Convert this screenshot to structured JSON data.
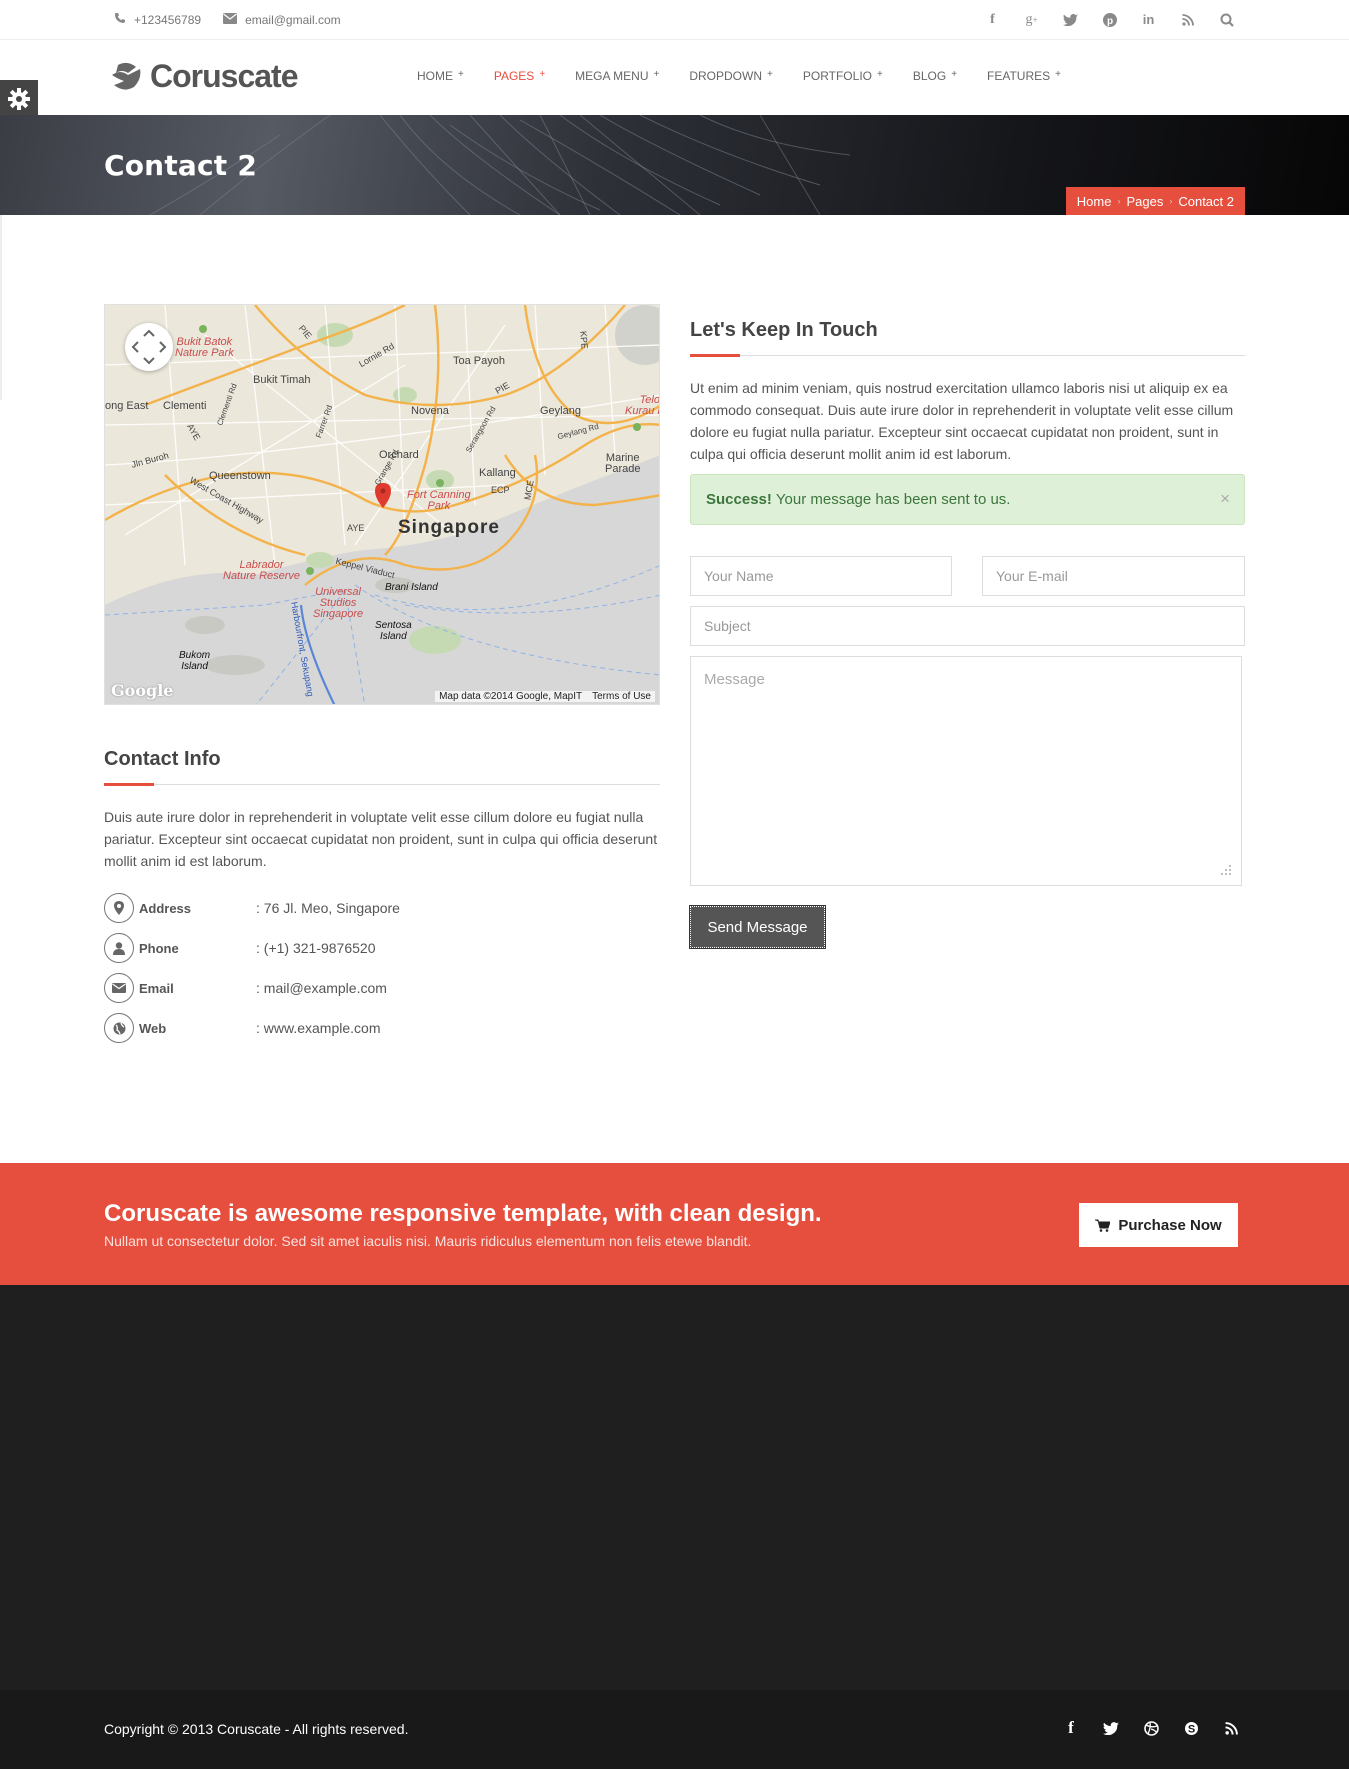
{
  "topbar": {
    "phone": "+123456789",
    "email": "email@gmail.com",
    "social_icons": [
      "facebook-icon",
      "google-plus-icon",
      "twitter-icon",
      "pinterest-icon",
      "linkedin-icon",
      "rss-icon",
      "search-icon"
    ]
  },
  "header": {
    "logo_text": "Coruscate",
    "nav": [
      {
        "label": "HOME",
        "plus": "+"
      },
      {
        "label": "PAGES",
        "plus": "+"
      },
      {
        "label": "MEGA MENU",
        "plus": "+"
      },
      {
        "label": "DROPDOWN",
        "plus": "+"
      },
      {
        "label": "PORTFOLIO",
        "plus": "+"
      },
      {
        "label": "BLOG",
        "plus": "+"
      },
      {
        "label": "FEATURES",
        "plus": "+"
      }
    ],
    "active_nav": "PAGES"
  },
  "banner": {
    "title": "Contact 2",
    "breadcrumb": [
      "Home",
      "Pages",
      "Contact 2"
    ],
    "breadcrumb_sep": "›"
  },
  "map": {
    "labels": {
      "bukit_batok": "Bukit Batok\nNature Park",
      "bukit_timah": "Bukit Timah",
      "toa_payoh": "Toa Payoh",
      "clementi": "Clementi",
      "jong_east": "ong East",
      "novena": "Novena",
      "geylang": "Geylang",
      "telok": "Telok\nKurau Park",
      "orchard": "Orchard",
      "queenstown": "Queenstown",
      "kallang": "Kallang",
      "marine_parade": "Marine\nParade",
      "fort_canning": "Fort Canning\nPark",
      "singapore": "Singapore",
      "labrador": "Labrador\nNature Reserve",
      "universal": "Universal\nStudios\nSingapore",
      "brani": "Brani Island",
      "sentosa": "Sentosa\nIsland",
      "bukom": "Bukom\nIsland",
      "west_coast": "West Coast Highway",
      "keppel": "Keppel Viaduct",
      "harbourfront": "Harbourfront, Sekupang",
      "pie": "PIE",
      "aye": "AYE",
      "ecp": "ECP",
      "mce": "MCE",
      "lorong": "Lornie Rd",
      "jln_buroh": "Jln Buroh",
      "clementi_rd": "Clementi Rd",
      "farrer": "Farrer Rd",
      "grange": "Grange Rd",
      "serangoon": "Serangoon Rd",
      "geylang_rd": "Geylang Rd",
      "kpe": "KPE"
    },
    "google": "Google",
    "map_data": "Map data ©2014 Google, MapIT",
    "terms": "Terms of Use"
  },
  "contact_info": {
    "heading": "Contact Info",
    "text": "Duis aute irure dolor in reprehenderit in voluptate velit esse cillum dolore eu fugiat nulla pariatur. Excepteur sint occaecat cupidatat non proident, sunt in culpa qui officia deserunt mollit anim id est laborum.",
    "rows": [
      {
        "icon": "map-marker-icon",
        "label": "Address",
        "value": ": 76 Jl. Meo, Singapore"
      },
      {
        "icon": "user-icon",
        "label": "Phone",
        "value": ": (+1) 321-9876520"
      },
      {
        "icon": "envelope-icon",
        "label": "Email",
        "value": ": mail@example.com"
      },
      {
        "icon": "globe-icon",
        "label": "Web",
        "value": ": www.example.com"
      }
    ]
  },
  "touch": {
    "heading": "Let's Keep In Touch",
    "text": "Ut enim ad minim veniam, quis nostrud exercitation ullamco laboris nisi ut aliquip ex ea commodo consequat. Duis aute irure dolor in reprehenderit in voluptate velit esse cillum dolore eu fugiat nulla pariatur. Excepteur sint occaecat cupidatat non proident, sunt in culpa qui officia deserunt mollit anim id est laborum.",
    "alert_strong": "Success!",
    "alert_text": "Your message has been sent to us.",
    "alert_close": "×",
    "name_placeholder": "Your Name",
    "email_placeholder": "Your E-mail",
    "subject_placeholder": "Subject",
    "message_placeholder": "Message",
    "send_label": "Send Message"
  },
  "cta": {
    "title": "Coruscate is awesome responsive template, with clean design.",
    "subtitle": "Nullam ut consectetur dolor. Sed sit amet iaculis nisi. Mauris ridiculus elementum non felis etewe blandit.",
    "button": "Purchase Now"
  },
  "footer": {
    "copyright": "Copyright © 2013 Coruscate - All rights reserved.",
    "social_icons": [
      "facebook-icon",
      "twitter-icon",
      "dribbble-icon",
      "skype-icon",
      "rss-icon"
    ]
  },
  "colors": {
    "accent": "#e64e3e",
    "dark": "#1f1f1f",
    "success_bg": "#dff0d8"
  }
}
